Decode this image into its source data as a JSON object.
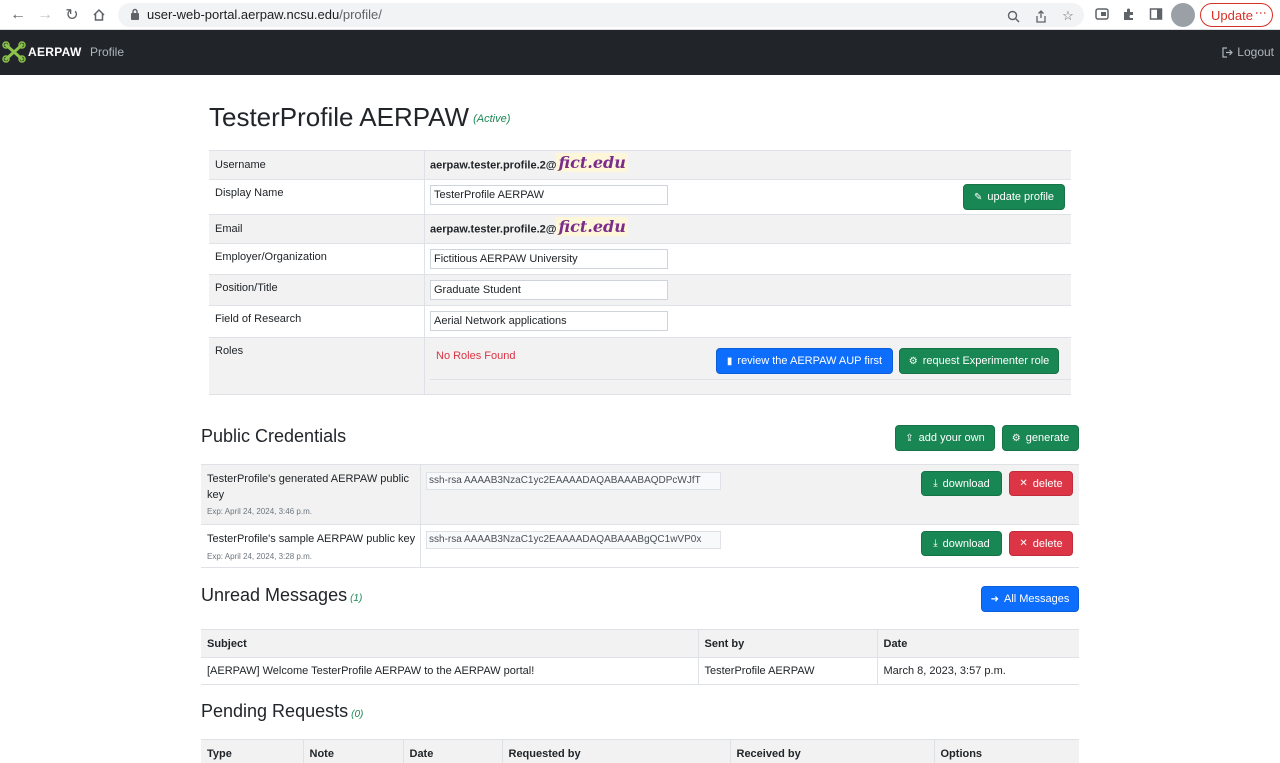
{
  "browser": {
    "url_host": "user-web-portal.aerpaw.ncsu.edu",
    "url_path": "/profile/",
    "update_label": "Update"
  },
  "navbar": {
    "brand": "AERPAW",
    "profile_link": "Profile",
    "logout_link": "Logout"
  },
  "profile": {
    "name": "TesterProfile AERPAW",
    "status": "(Active)",
    "fields": {
      "username_label": "Username",
      "username_value": "aerpaw.tester.profile.2@",
      "username_redacted": "fict.edu",
      "display_name_label": "Display Name",
      "display_name_value": "TesterProfile AERPAW",
      "email_label": "Email",
      "email_value": "aerpaw.tester.profile.2@",
      "email_redacted": "fict.edu",
      "employer_label": "Employer/Organization",
      "employer_value": "Fictitious AERPAW University",
      "position_label": "Position/Title",
      "position_value": "Graduate Student",
      "research_label": "Field of Research",
      "research_value": "Aerial Network applications",
      "roles_label": "Roles",
      "roles_value": "No Roles Found"
    },
    "update_button": "update profile",
    "review_aup_button": "review the AERPAW AUP first",
    "request_role_button": "request Experimenter role"
  },
  "credentials": {
    "title": "Public Credentials",
    "add_button": "add your own",
    "generate_button": "generate",
    "download_label": "download",
    "delete_label": "delete",
    "items": [
      {
        "name": "TesterProfile's generated AERPAW public key",
        "exp": "Exp: April 24, 2024, 3:46 p.m.",
        "key": "ssh-rsa AAAAB3NzaC1yc2EAAAADAQABAAABAQDPcWJfT"
      },
      {
        "name": "TesterProfile's sample AERPAW public key",
        "exp": "Exp: April 24, 2024, 3:28 p.m.",
        "key": "ssh-rsa AAAAB3NzaC1yc2EAAAADAQABAAABgQC1wVP0x"
      }
    ]
  },
  "messages": {
    "title": "Unread Messages",
    "count": "(1)",
    "all_button": "All Messages",
    "headers": [
      "Subject",
      "Sent by",
      "Date"
    ],
    "rows": [
      {
        "subject": "[AERPAW] Welcome TesterProfile AERPAW to the AERPAW portal!",
        "sent_by": "TesterProfile AERPAW",
        "date": "March 8, 2023, 3:57 p.m."
      }
    ]
  },
  "pending": {
    "title": "Pending Requests",
    "count": "(0)",
    "headers": [
      "Type",
      "Note",
      "Date",
      "Requested by",
      "Received by",
      "Options"
    ]
  },
  "colors": {
    "green": "#198754",
    "blue": "#0d6efd",
    "red": "#dc3545",
    "navbar": "#212529"
  }
}
